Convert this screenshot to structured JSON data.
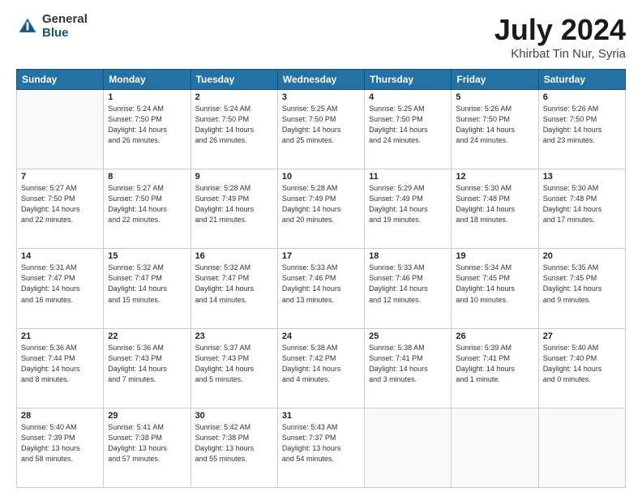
{
  "header": {
    "logo_general": "General",
    "logo_blue": "Blue",
    "main_title": "July 2024",
    "subtitle": "Khirbat Tin Nur, Syria"
  },
  "days_of_week": [
    "Sunday",
    "Monday",
    "Tuesday",
    "Wednesday",
    "Thursday",
    "Friday",
    "Saturday"
  ],
  "weeks": [
    [
      {
        "day": "",
        "info": ""
      },
      {
        "day": "1",
        "info": "Sunrise: 5:24 AM\nSunset: 7:50 PM\nDaylight: 14 hours\nand 26 minutes."
      },
      {
        "day": "2",
        "info": "Sunrise: 5:24 AM\nSunset: 7:50 PM\nDaylight: 14 hours\nand 26 minutes."
      },
      {
        "day": "3",
        "info": "Sunrise: 5:25 AM\nSunset: 7:50 PM\nDaylight: 14 hours\nand 25 minutes."
      },
      {
        "day": "4",
        "info": "Sunrise: 5:25 AM\nSunset: 7:50 PM\nDaylight: 14 hours\nand 24 minutes."
      },
      {
        "day": "5",
        "info": "Sunrise: 5:26 AM\nSunset: 7:50 PM\nDaylight: 14 hours\nand 24 minutes."
      },
      {
        "day": "6",
        "info": "Sunrise: 5:26 AM\nSunset: 7:50 PM\nDaylight: 14 hours\nand 23 minutes."
      }
    ],
    [
      {
        "day": "7",
        "info": "Sunrise: 5:27 AM\nSunset: 7:50 PM\nDaylight: 14 hours\nand 22 minutes."
      },
      {
        "day": "8",
        "info": "Sunrise: 5:27 AM\nSunset: 7:50 PM\nDaylight: 14 hours\nand 22 minutes."
      },
      {
        "day": "9",
        "info": "Sunrise: 5:28 AM\nSunset: 7:49 PM\nDaylight: 14 hours\nand 21 minutes."
      },
      {
        "day": "10",
        "info": "Sunrise: 5:28 AM\nSunset: 7:49 PM\nDaylight: 14 hours\nand 20 minutes."
      },
      {
        "day": "11",
        "info": "Sunrise: 5:29 AM\nSunset: 7:49 PM\nDaylight: 14 hours\nand 19 minutes."
      },
      {
        "day": "12",
        "info": "Sunrise: 5:30 AM\nSunset: 7:48 PM\nDaylight: 14 hours\nand 18 minutes."
      },
      {
        "day": "13",
        "info": "Sunrise: 5:30 AM\nSunset: 7:48 PM\nDaylight: 14 hours\nand 17 minutes."
      }
    ],
    [
      {
        "day": "14",
        "info": "Sunrise: 5:31 AM\nSunset: 7:47 PM\nDaylight: 14 hours\nand 16 minutes."
      },
      {
        "day": "15",
        "info": "Sunrise: 5:32 AM\nSunset: 7:47 PM\nDaylight: 14 hours\nand 15 minutes."
      },
      {
        "day": "16",
        "info": "Sunrise: 5:32 AM\nSunset: 7:47 PM\nDaylight: 14 hours\nand 14 minutes."
      },
      {
        "day": "17",
        "info": "Sunrise: 5:33 AM\nSunset: 7:46 PM\nDaylight: 14 hours\nand 13 minutes."
      },
      {
        "day": "18",
        "info": "Sunrise: 5:33 AM\nSunset: 7:46 PM\nDaylight: 14 hours\nand 12 minutes."
      },
      {
        "day": "19",
        "info": "Sunrise: 5:34 AM\nSunset: 7:45 PM\nDaylight: 14 hours\nand 10 minutes."
      },
      {
        "day": "20",
        "info": "Sunrise: 5:35 AM\nSunset: 7:45 PM\nDaylight: 14 hours\nand 9 minutes."
      }
    ],
    [
      {
        "day": "21",
        "info": "Sunrise: 5:36 AM\nSunset: 7:44 PM\nDaylight: 14 hours\nand 8 minutes."
      },
      {
        "day": "22",
        "info": "Sunrise: 5:36 AM\nSunset: 7:43 PM\nDaylight: 14 hours\nand 7 minutes."
      },
      {
        "day": "23",
        "info": "Sunrise: 5:37 AM\nSunset: 7:43 PM\nDaylight: 14 hours\nand 5 minutes."
      },
      {
        "day": "24",
        "info": "Sunrise: 5:38 AM\nSunset: 7:42 PM\nDaylight: 14 hours\nand 4 minutes."
      },
      {
        "day": "25",
        "info": "Sunrise: 5:38 AM\nSunset: 7:41 PM\nDaylight: 14 hours\nand 3 minutes."
      },
      {
        "day": "26",
        "info": "Sunrise: 5:39 AM\nSunset: 7:41 PM\nDaylight: 14 hours\nand 1 minute."
      },
      {
        "day": "27",
        "info": "Sunrise: 5:40 AM\nSunset: 7:40 PM\nDaylight: 14 hours\nand 0 minutes."
      }
    ],
    [
      {
        "day": "28",
        "info": "Sunrise: 5:40 AM\nSunset: 7:39 PM\nDaylight: 13 hours\nand 58 minutes."
      },
      {
        "day": "29",
        "info": "Sunrise: 5:41 AM\nSunset: 7:38 PM\nDaylight: 13 hours\nand 57 minutes."
      },
      {
        "day": "30",
        "info": "Sunrise: 5:42 AM\nSunset: 7:38 PM\nDaylight: 13 hours\nand 55 minutes."
      },
      {
        "day": "31",
        "info": "Sunrise: 5:43 AM\nSunset: 7:37 PM\nDaylight: 13 hours\nand 54 minutes."
      },
      {
        "day": "",
        "info": ""
      },
      {
        "day": "",
        "info": ""
      },
      {
        "day": "",
        "info": ""
      }
    ]
  ]
}
